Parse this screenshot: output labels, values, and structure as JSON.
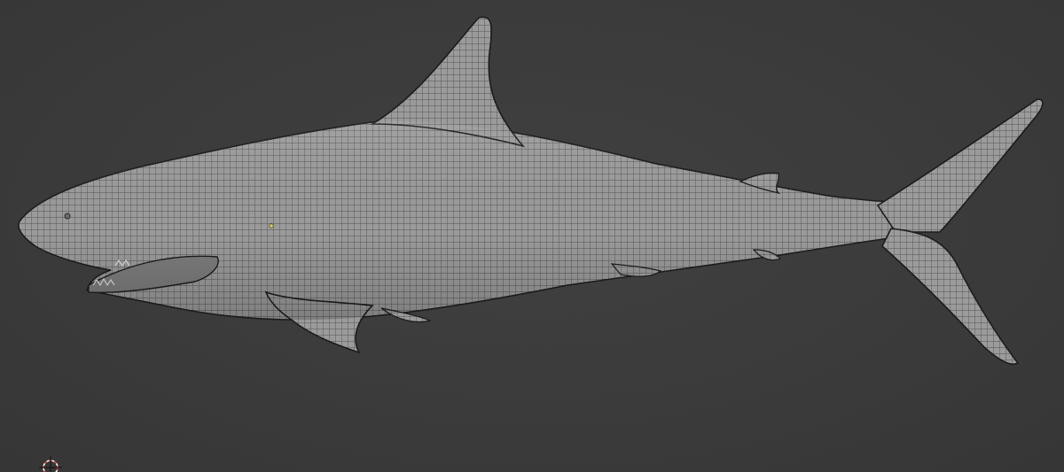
{
  "app": {
    "title": "",
    "view": "3d-viewport"
  },
  "viewport": {
    "background": "#3a3a3a",
    "mesh_display": "wireframe-overlay",
    "object": "shark",
    "mesh_fill": "#9a9a9a",
    "wire_color": "#2a2a2a",
    "selected_vertex_color": "#d8c85a"
  },
  "overlays": {
    "cursor_icon": "3d-cursor-icon"
  }
}
